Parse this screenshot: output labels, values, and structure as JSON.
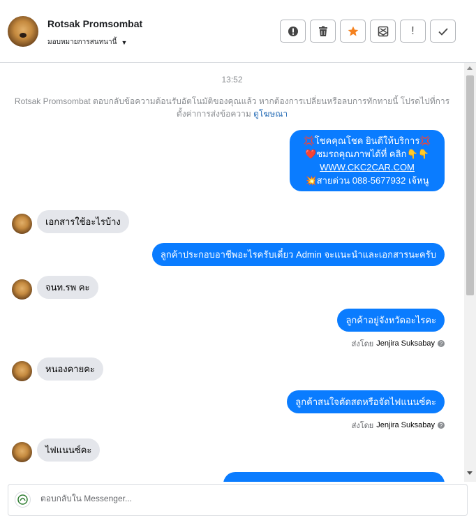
{
  "header": {
    "name": "Rotsak Promsombat",
    "assign_label": "มอบหมายการสนทนานี้"
  },
  "tools": {
    "spam": "spam-icon",
    "delete": "trash-icon",
    "star": "star-icon",
    "move": "mail-move-icon",
    "mark": "!",
    "done": "check-icon"
  },
  "chat": {
    "time": "13:52",
    "notice_text": "Rotsak Promsombat ตอบกลับข้อความต้อนรับอัตโนมัติของคุณแล้ว หากต้องการเปลี่ยนหรือลบการทักทายนี้ โปรดไปที่การตั้งค่าการส่งข้อความ",
    "notice_link": "ดูโฆษณา",
    "welcome_lines": [
      "💢โชคคุณโชค ยินดีให้บริการ💢",
      "❤️ชมรถคุณภาพได้ที่   คลิก👇👇",
      "WWW.CKC2CAR.COM",
      "💥สายด่วน 088-5677932 เจ้หนู"
    ],
    "msg_in_1": "เอกสารใช้อะไรบ้าง",
    "msg_out_1": "ลูกค้าประกอบอาชีพอะไรครับเดี๋ยว Admin จะแนะนำและเอกสารนะครับ",
    "msg_in_2": "จนท.รพ คะ",
    "msg_out_2": "ลูกค้าอยู่จังหวัดอะไรคะ",
    "sent_by_label": "ส่งโดย",
    "sent_by_name": "Jenjira Suksabay",
    "msg_in_3": "หนองคายคะ",
    "msg_out_3": "ลูกค้าสนใจตัดสดหรือจัดไฟแนนซ์คะ",
    "msg_in_4": "ไฟแนนซ์คะ"
  },
  "composer": {
    "placeholder": "ตอบกลับใน Messenger..."
  },
  "colors": {
    "outgoing": "#0a7cff",
    "incoming": "#e4e6eb",
    "star": "#f5821f"
  }
}
